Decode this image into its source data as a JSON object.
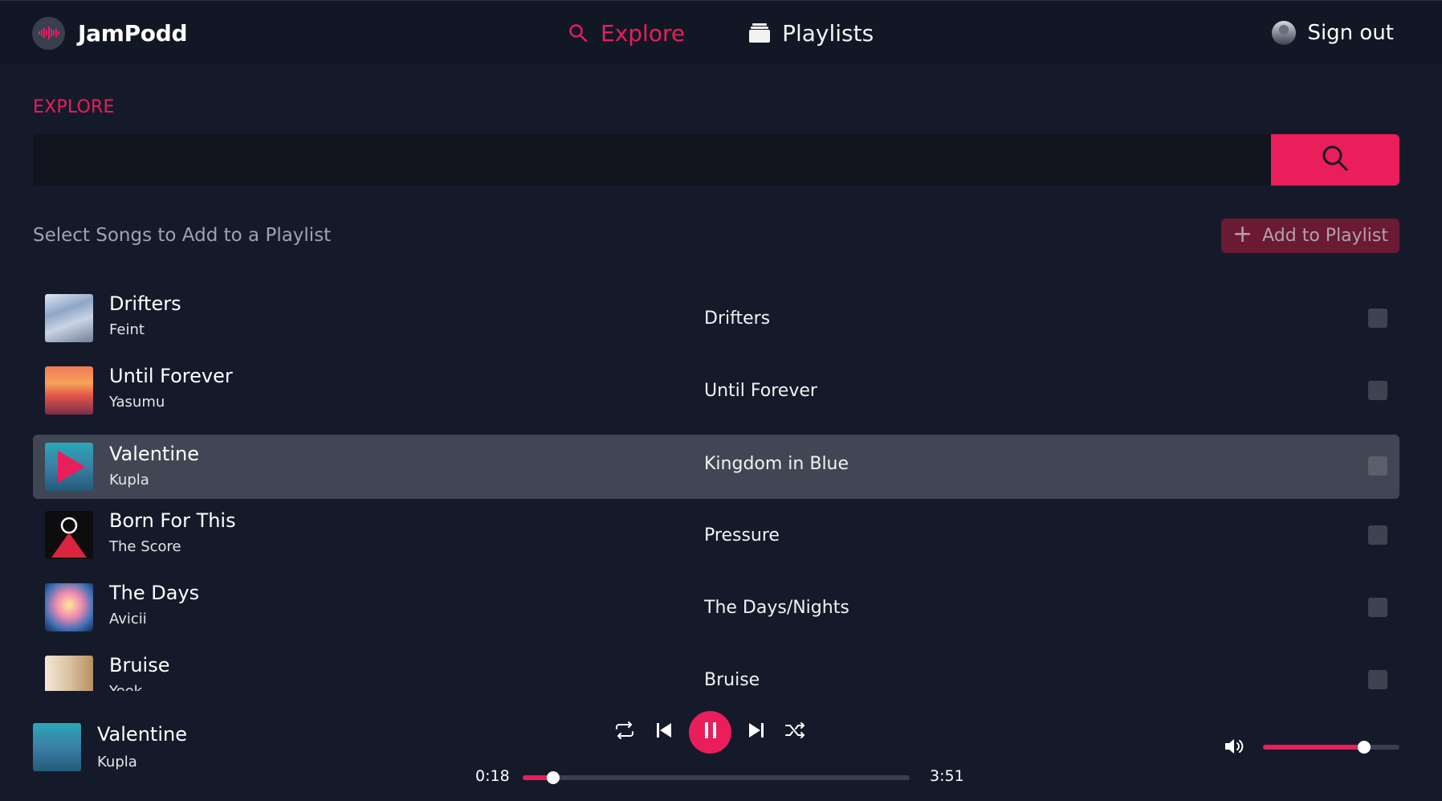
{
  "app": {
    "brand": "JamPodd",
    "logo_icon": "audio-wave-icon",
    "accent_color": "#e91e5a"
  },
  "nav": {
    "explore_label": "Explore",
    "explore_icon": "search-icon",
    "playlists_label": "Playlists",
    "playlists_icon": "stack-icon",
    "signout_label": "Sign out"
  },
  "explore": {
    "section_label": "EXPLORE",
    "search_value": "",
    "search_placeholder": "",
    "subheading": "Select Songs to Add to a Playlist",
    "add_button_label": "Add to Playlist"
  },
  "songs": [
    {
      "title": "Drifters",
      "artist": "Feint",
      "album": "Drifters",
      "selected": false,
      "highlighted": false
    },
    {
      "title": "Until Forever",
      "artist": "Yasumu",
      "album": "Until Forever",
      "selected": false,
      "highlighted": false
    },
    {
      "title": "Valentine",
      "artist": "Kupla",
      "album": "Kingdom in Blue",
      "selected": false,
      "highlighted": true
    },
    {
      "title": "Born For This",
      "artist": "The Score",
      "album": "Pressure",
      "selected": false,
      "highlighted": false
    },
    {
      "title": "The Days",
      "artist": "Avicii",
      "album": "The Days/Nights",
      "selected": false,
      "highlighted": false
    },
    {
      "title": "Bruise",
      "artist": "Yeek",
      "album": "Bruise",
      "selected": false,
      "highlighted": false
    }
  ],
  "player": {
    "title": "Valentine",
    "artist": "Kupla",
    "current_time": "0:18",
    "total_time": "3:51",
    "progress_fraction": 0.078,
    "volume_fraction": 0.74,
    "state": "playing"
  }
}
